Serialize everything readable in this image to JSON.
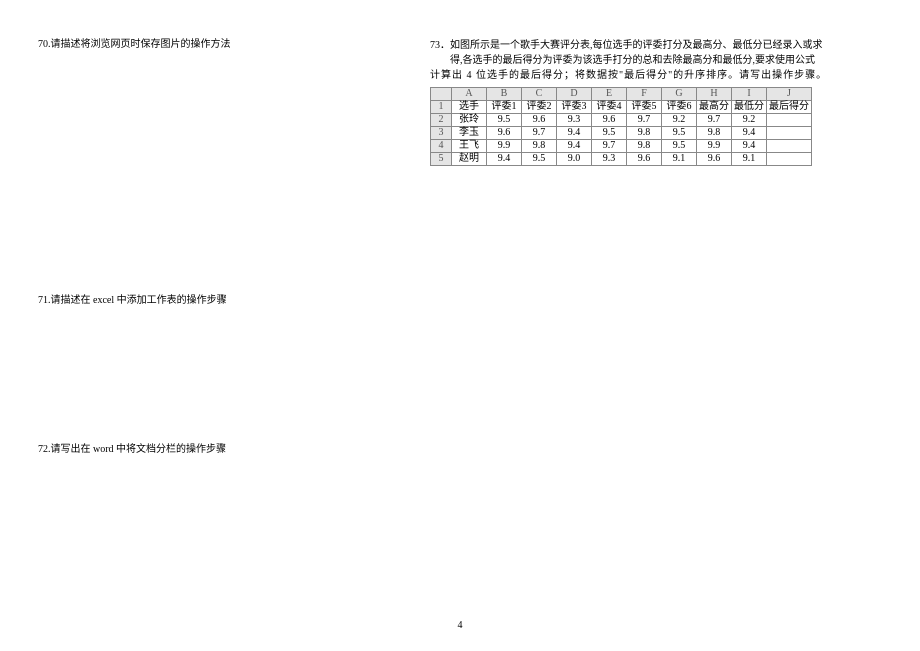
{
  "q70": "70.请描述将浏览网页时保存图片的操作方法",
  "q71": "71.请描述在 excel 中添加工作表的操作步骤",
  "q72": "72.请写出在 word 中将文档分栏的操作步骤",
  "q73_line1": "73．如图所示是一个歌手大赛评分表,每位选手的评委打分及最高分、最低分已经录入或求",
  "q73_line2": "得,各选手的最后得分为评委为该选手打分的总和去除最高分和最低分,要求使用公式",
  "q73_line3": "计算出 4 位选手的最后得分；将数据按\"最后得分\"的升序排序。请写出操作步骤。",
  "page_number": "4",
  "chart_data": {
    "type": "table",
    "col_letters": [
      "A",
      "B",
      "C",
      "D",
      "E",
      "F",
      "G",
      "H",
      "I",
      "J"
    ],
    "row_nums": [
      "1",
      "2",
      "3",
      "4",
      "5"
    ],
    "headers": [
      "选手",
      "评委1",
      "评委2",
      "评委3",
      "评委4",
      "评委5",
      "评委6",
      "最高分",
      "最低分",
      "最后得分"
    ],
    "rows": [
      {
        "name": "张玲",
        "v": [
          "9.5",
          "9.6",
          "9.3",
          "9.6",
          "9.7",
          "9.2",
          "9.7",
          "9.2",
          ""
        ]
      },
      {
        "name": "李玉",
        "v": [
          "9.6",
          "9.7",
          "9.4",
          "9.5",
          "9.8",
          "9.5",
          "9.8",
          "9.4",
          ""
        ]
      },
      {
        "name": "王飞",
        "v": [
          "9.9",
          "9.8",
          "9.4",
          "9.7",
          "9.8",
          "9.5",
          "9.9",
          "9.4",
          ""
        ]
      },
      {
        "name": "赵明",
        "v": [
          "9.4",
          "9.5",
          "9.0",
          "9.3",
          "9.6",
          "9.1",
          "9.6",
          "9.1",
          ""
        ]
      }
    ]
  }
}
